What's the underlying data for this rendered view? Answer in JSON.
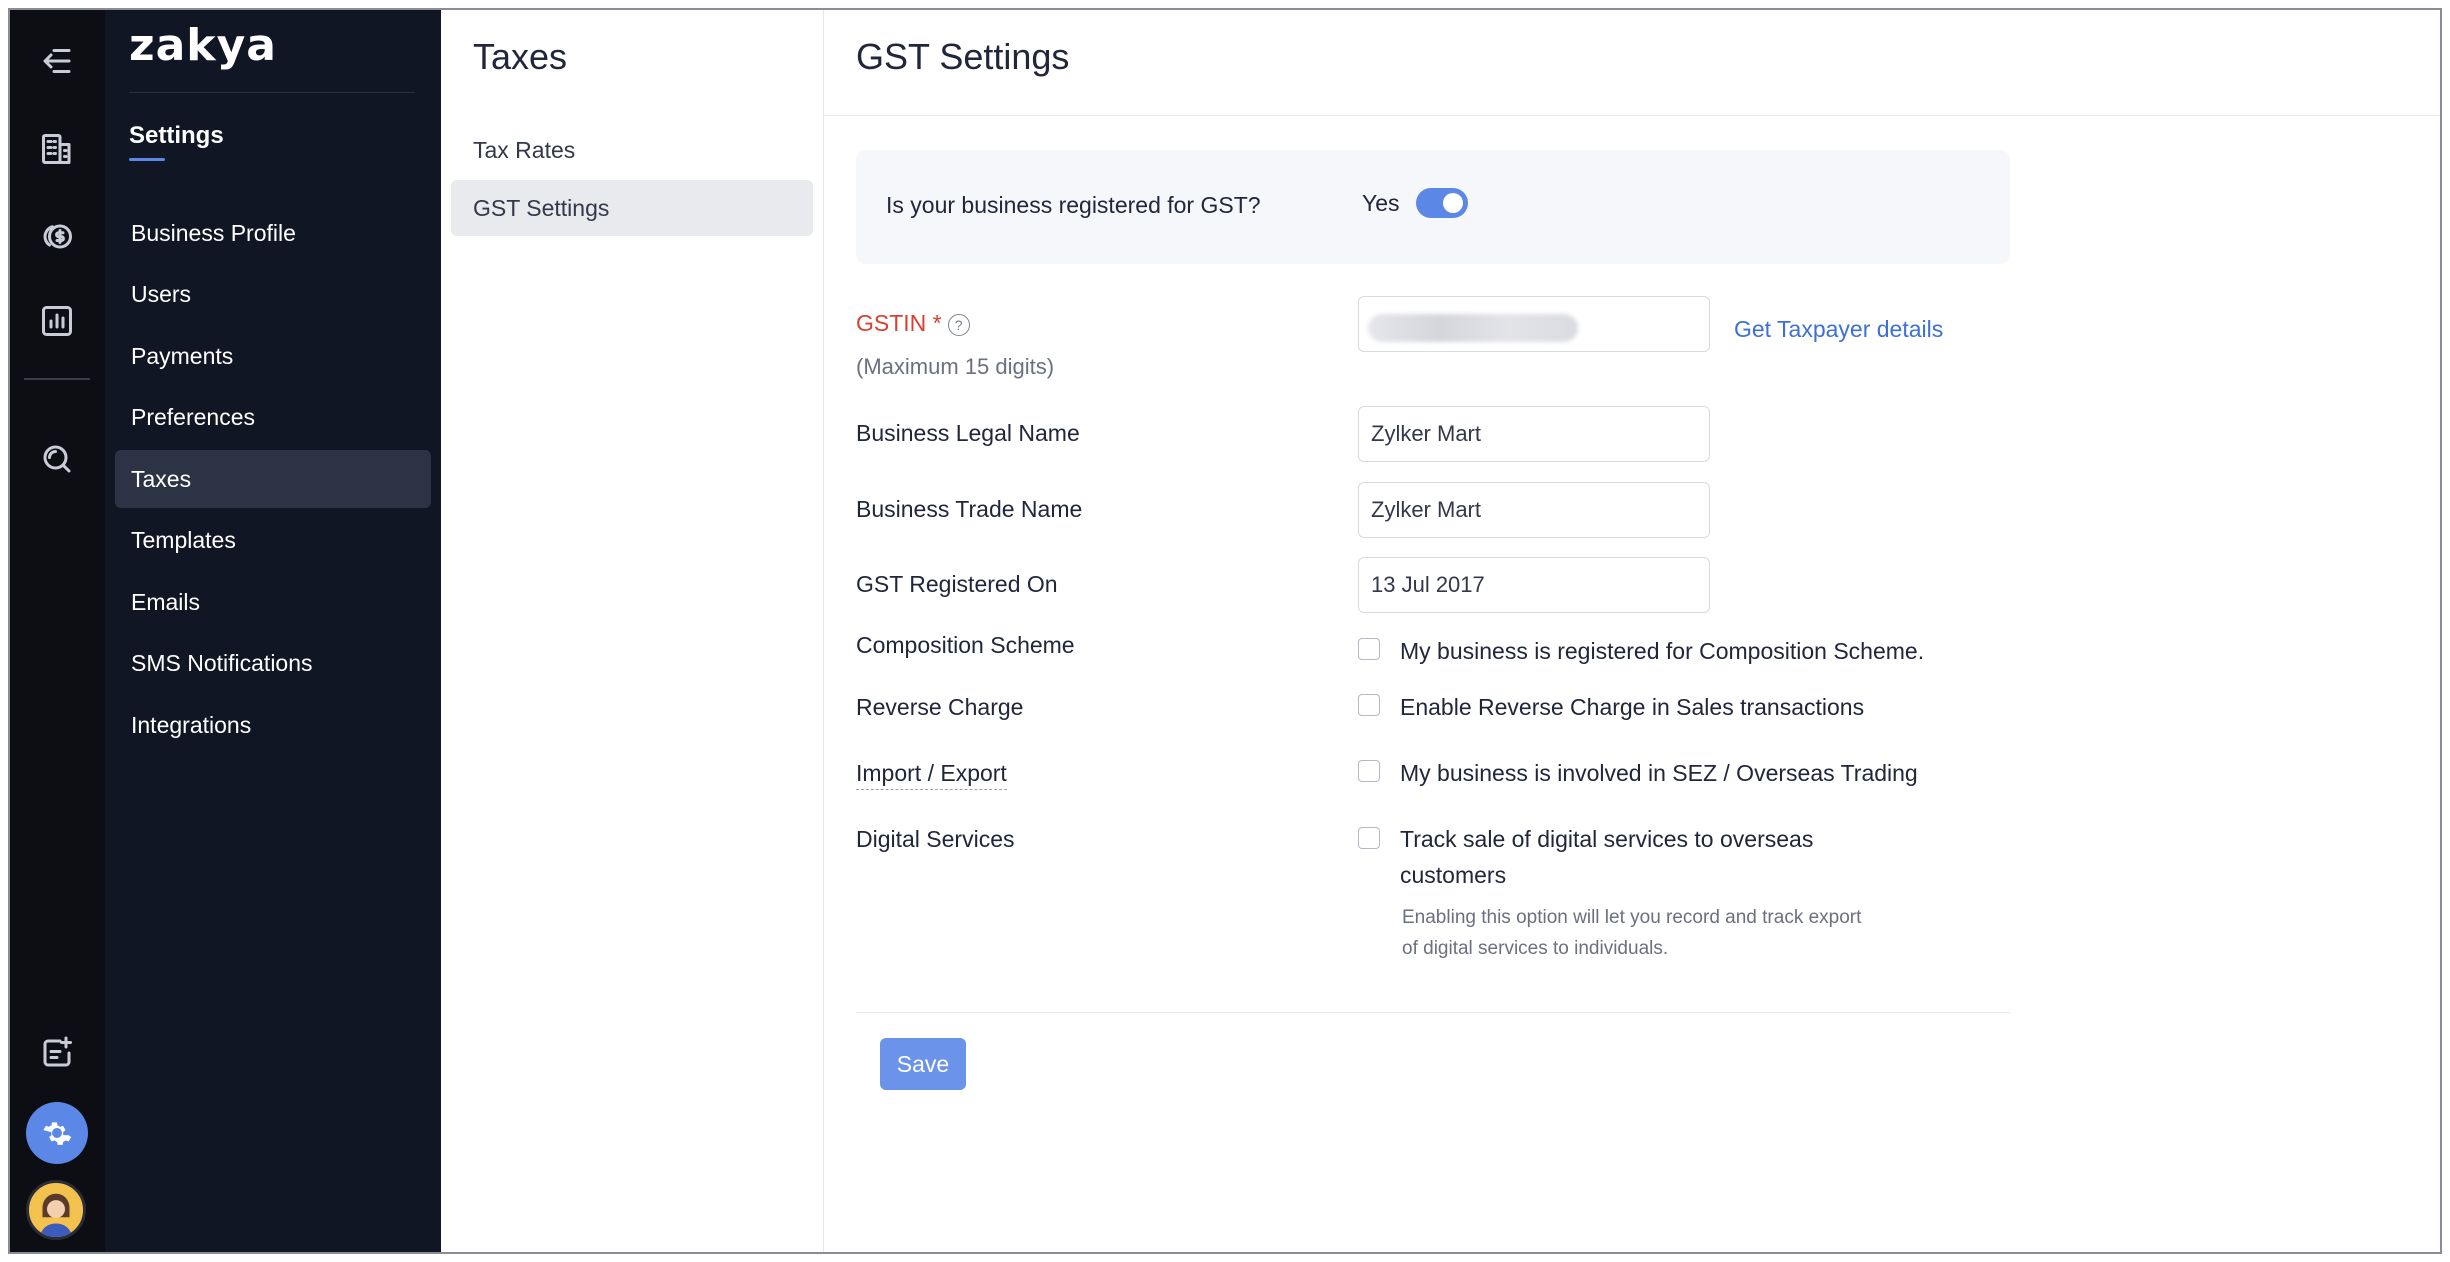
{
  "brand": {
    "logo_text": "zakya"
  },
  "rail": {
    "icons": [
      "collapse-menu-icon",
      "building-icon",
      "coin-stack-icon",
      "chart-icon",
      "search-icon",
      "compose-icon",
      "gear-icon",
      "user-avatar"
    ]
  },
  "sidenav": {
    "title": "Settings",
    "items": [
      {
        "label": "Business Profile"
      },
      {
        "label": "Users"
      },
      {
        "label": "Payments"
      },
      {
        "label": "Preferences"
      },
      {
        "label": "Taxes",
        "active": true
      },
      {
        "label": "Templates"
      },
      {
        "label": "Emails"
      },
      {
        "label": "SMS Notifications"
      },
      {
        "label": "Integrations"
      }
    ]
  },
  "subnav": {
    "title": "Taxes",
    "items": [
      {
        "label": "Tax Rates"
      },
      {
        "label": "GST Settings",
        "active": true
      }
    ]
  },
  "main": {
    "title": "GST Settings",
    "gst_question": "Is your business registered for GST?",
    "gst_answer": "Yes",
    "gst_registered": true,
    "gstin": {
      "label": "GSTIN *",
      "hint": "(Maximum 15 digits)",
      "value": "",
      "link": "Get Taxpayer details"
    },
    "legal_name": {
      "label": "Business Legal Name",
      "value": "Zylker Mart"
    },
    "trade_name": {
      "label": "Business Trade Name",
      "value": "Zylker Mart"
    },
    "registered_on": {
      "label": "GST Registered On",
      "value": "13 Jul 2017"
    },
    "composition": {
      "label": "Composition Scheme",
      "option": "My business is registered for Composition Scheme.",
      "checked": false
    },
    "reverse_charge": {
      "label": "Reverse Charge",
      "option": "Enable Reverse Charge in Sales transactions",
      "checked": false
    },
    "import_export": {
      "label": "Import / Export",
      "option": "My business is involved in SEZ / Overseas Trading",
      "checked": false
    },
    "digital": {
      "label": "Digital Services",
      "option_line1": "Track sale of digital services to overseas",
      "option_line2": "customers",
      "help_line1": "Enabling this option will let you record and track export",
      "help_line2": "of digital services to individuals.",
      "checked": false
    },
    "save_label": "Save"
  },
  "colors": {
    "accent": "#5b87e6",
    "required": "#d8412f",
    "link": "#3e6fd9",
    "sidebar_bg": "#111624",
    "rail_bg": "#0c0e14"
  }
}
